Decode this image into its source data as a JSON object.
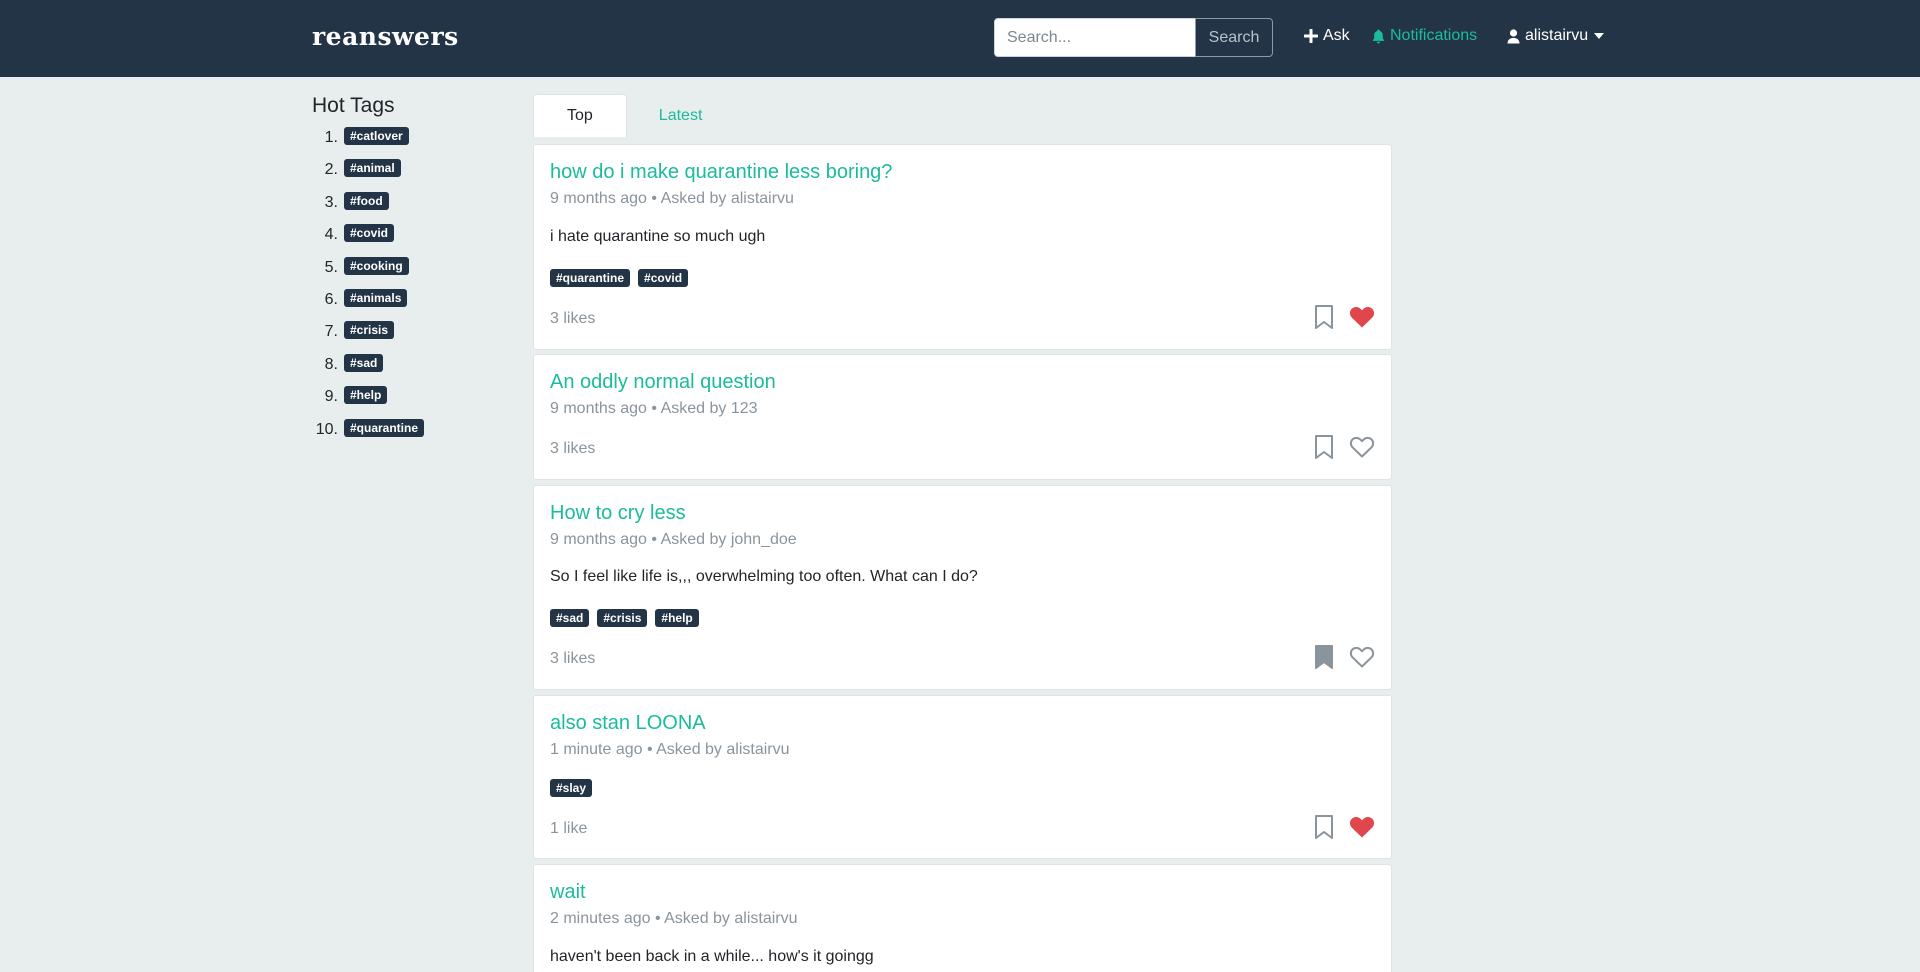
{
  "nav": {
    "brand": "reanswers",
    "search_placeholder": "Search...",
    "search_button": "Search",
    "ask": "Ask",
    "notifications": "Notifications",
    "user": "alistairvu"
  },
  "sidebar": {
    "title": "Hot Tags",
    "tags": [
      {
        "num": "1.",
        "label": "#catlover"
      },
      {
        "num": "2.",
        "label": "#animal"
      },
      {
        "num": "3.",
        "label": "#food"
      },
      {
        "num": "4.",
        "label": "#covid"
      },
      {
        "num": "5.",
        "label": "#cooking"
      },
      {
        "num": "6.",
        "label": "#animals"
      },
      {
        "num": "7.",
        "label": "#crisis"
      },
      {
        "num": "8.",
        "label": "#sad"
      },
      {
        "num": "9.",
        "label": "#help"
      },
      {
        "num": "10.",
        "label": "#quarantine"
      }
    ]
  },
  "tabs": [
    {
      "label": "Top",
      "active": true
    },
    {
      "label": "Latest",
      "active": false
    }
  ],
  "questions": [
    {
      "title": "how do i make quarantine less boring?",
      "meta": "9 months ago • Asked by alistairvu",
      "body": "i hate quarantine so much ugh",
      "tags": [
        "#quarantine",
        "#covid"
      ],
      "likes": "3 likes",
      "bookmarked": false,
      "liked": true
    },
    {
      "title": "An oddly normal question",
      "meta": "9 months ago • Asked by 123",
      "body": "",
      "tags": [],
      "likes": "3 likes",
      "bookmarked": false,
      "liked": false
    },
    {
      "title": "How to cry less",
      "meta": "9 months ago • Asked by john_doe",
      "body": "So I feel like life is,,, overwhelming too often. What can I do?",
      "tags": [
        "#sad",
        "#crisis",
        "#help"
      ],
      "likes": "3 likes",
      "bookmarked": true,
      "liked": false
    },
    {
      "title": "also stan LOONA",
      "meta": "1 minute ago • Asked by alistairvu",
      "body": "",
      "tags": [
        "#slay"
      ],
      "likes": "1 like",
      "bookmarked": false,
      "liked": true
    },
    {
      "title": "wait",
      "meta": "2 minutes ago • Asked by alistairvu",
      "body": "haven't been back in a while... how's it goingg",
      "tags": [],
      "likes": "",
      "bookmarked": false,
      "liked": false
    }
  ],
  "colors": {
    "navbar": "#243447",
    "accent": "#1abc9c",
    "like_red": "#e0474c",
    "icon_gray": "#8a949d",
    "background": "#e8eeee"
  }
}
